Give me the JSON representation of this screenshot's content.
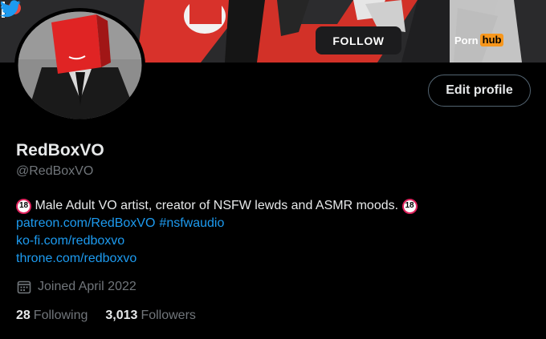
{
  "banner": {
    "follow_label": "FOLLOW",
    "ph_left": "Porn",
    "ph_right": "hub",
    "icons": [
      "patreon-icon",
      "pornhub-logo",
      "twitter-icon"
    ]
  },
  "profile": {
    "edit_label": "Edit profile",
    "display_name": "RedBoxVO",
    "handle": "@RedBoxVO",
    "bio_text": " Male Adult VO artist, creator of NSFW lewds and ASMR moods. ",
    "bio_badge": "18",
    "link_patreon": "patreon.com/RedBoxVO",
    "hashtag": "#nsfwaudio",
    "link_kofi": "ko-fi.com/redboxvo",
    "link_throne": "throne.com/redboxvo",
    "joined": "Joined April 2022"
  },
  "stats": {
    "following_count": "28",
    "following_label": "Following",
    "followers_count": "3,013",
    "followers_label": "Followers"
  },
  "colors": {
    "background": "#000000",
    "link": "#1d9bf0",
    "secondary_text": "#71767b",
    "banner_red": "#d8322b"
  }
}
